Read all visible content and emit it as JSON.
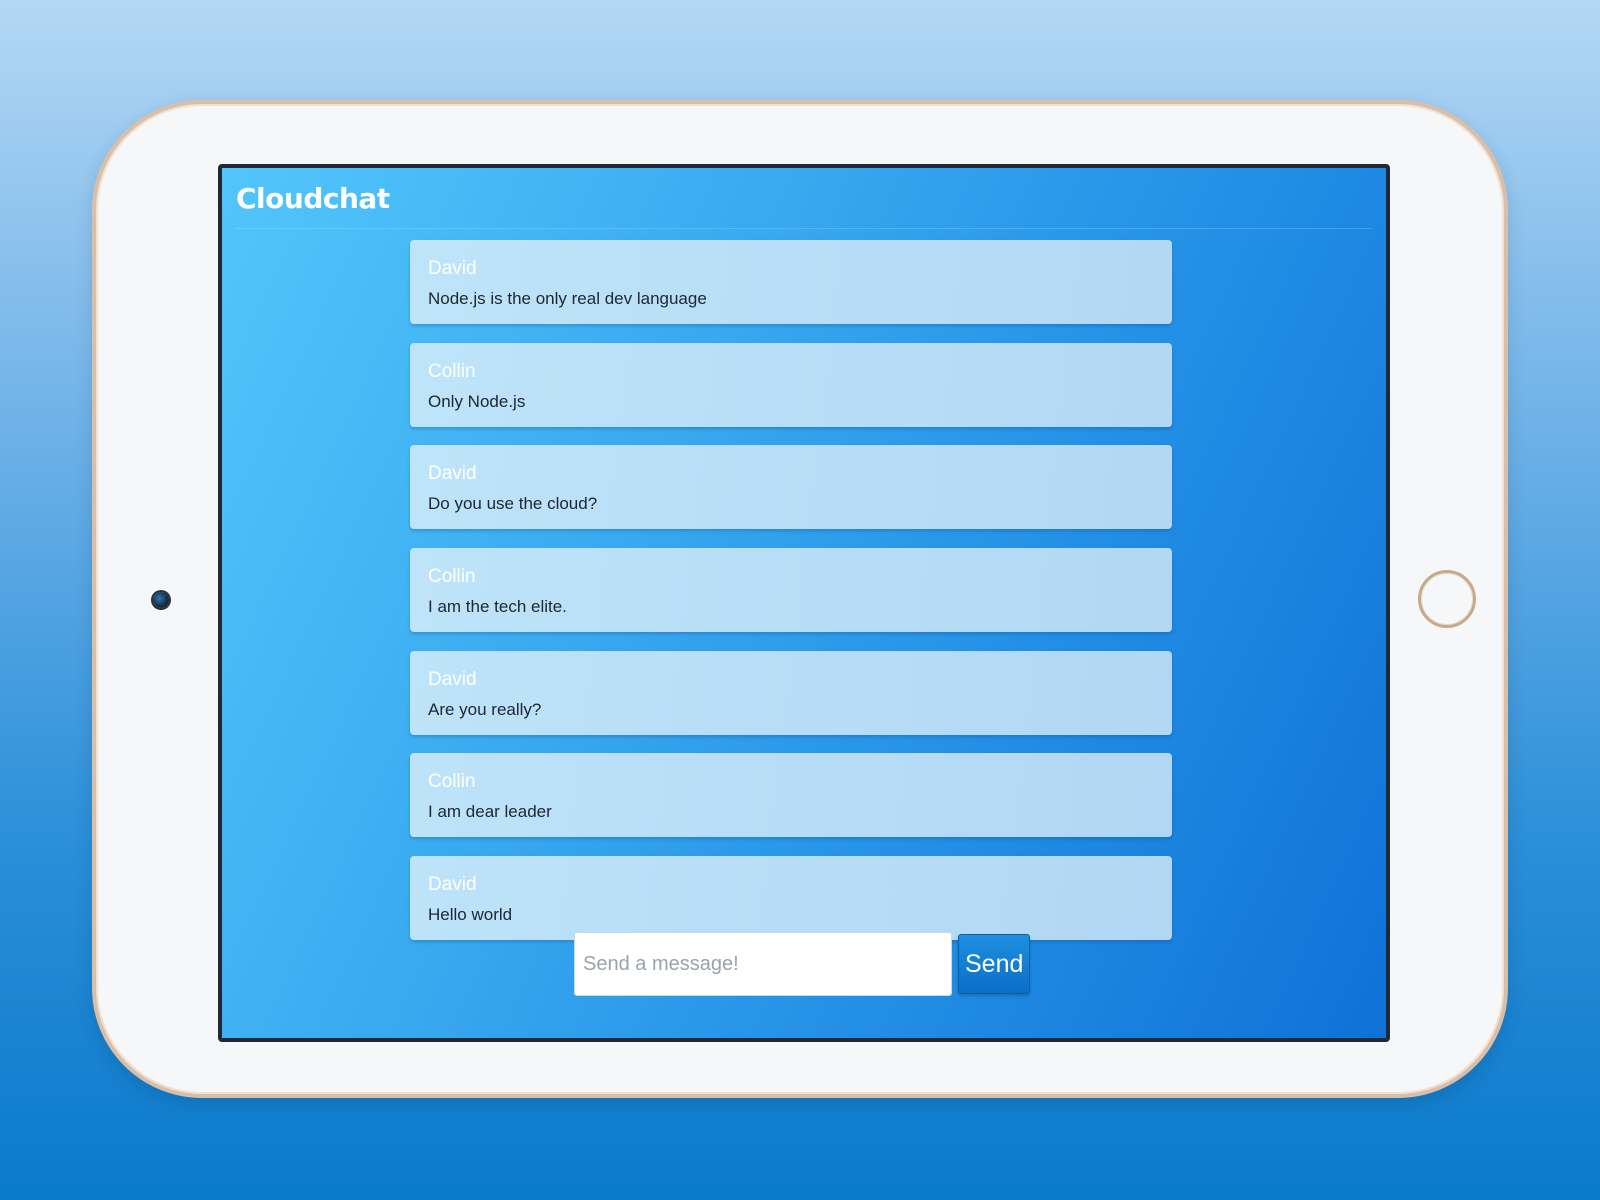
{
  "app": {
    "title": "Cloudchat"
  },
  "messages": [
    {
      "author": "David",
      "text": "Node.js is the only real dev language"
    },
    {
      "author": "Collin",
      "text": "Only Node.js"
    },
    {
      "author": "David",
      "text": "Do you use the cloud?"
    },
    {
      "author": "Collin",
      "text": "I am the tech elite."
    },
    {
      "author": "David",
      "text": "Are you really?"
    },
    {
      "author": "Collin",
      "text": "I am dear leader"
    },
    {
      "author": "David",
      "text": "Hello world"
    }
  ],
  "composer": {
    "placeholder": "Send a message!",
    "value": "",
    "send_label": "Send"
  },
  "colors": {
    "background_top": "#b3d7f4",
    "background_bottom": "#0a7acb",
    "screen_gradient_start": "#52c6fb",
    "screen_gradient_end": "#0e72d6",
    "send_button": "#1e8fe0"
  },
  "icons": {
    "camera": "camera-icon",
    "home_button": "home-button-icon"
  }
}
